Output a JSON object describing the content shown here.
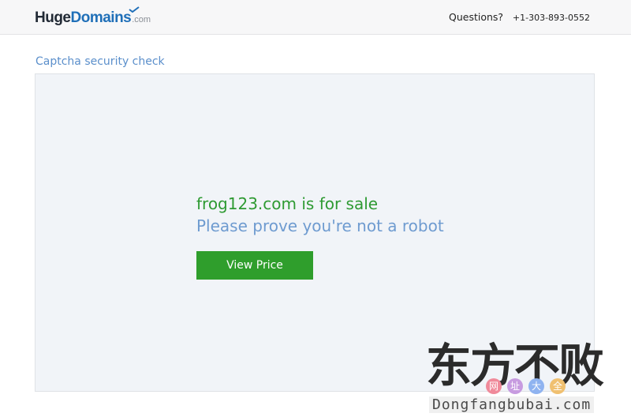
{
  "header": {
    "logo_huge": "Huge",
    "logo_domains": "Domains",
    "logo_tld": ".com",
    "questions_label": "Questions?",
    "phone": "+1-303-893-0552"
  },
  "breadcrumb": "Captcha security check",
  "main": {
    "sale_text": "frog123.com is for sale",
    "prove_text": "Please prove you're not a robot",
    "view_price_label": "View Price"
  },
  "watermark": {
    "chars": "东方不败",
    "badges": [
      "网",
      "址",
      "大",
      "全"
    ],
    "url": "Dongfangbubai.com"
  },
  "colors": {
    "brand_blue": "#1f6fb8",
    "link_blue": "#5b8fcb",
    "sale_green": "#2e9a32",
    "button_green": "#2f9e2c"
  }
}
